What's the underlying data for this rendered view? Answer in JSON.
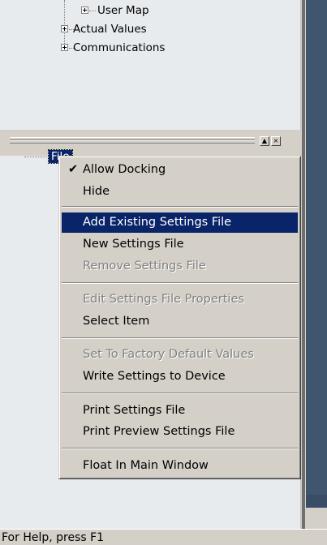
{
  "tree_top": {
    "items": [
      {
        "label": "User Map"
      },
      {
        "label": "Actual Values"
      },
      {
        "label": "Communications"
      }
    ]
  },
  "bottom_panel": {
    "node_label": "File",
    "buttons": {
      "restore_glyph": "▲",
      "close_glyph": "×"
    }
  },
  "context_menu": {
    "items": [
      {
        "label": "Allow Docking",
        "checked": true
      },
      {
        "label": "Hide"
      },
      {
        "label": "Add Existing Settings File",
        "highlighted": true
      },
      {
        "label": "New Settings File"
      },
      {
        "label": "Remove Settings File",
        "disabled": true
      },
      {
        "label": "Edit Settings File Properties",
        "disabled": true
      },
      {
        "label": "Select Item"
      },
      {
        "label": "Set To Factory Default Values",
        "disabled": true
      },
      {
        "label": "Write Settings to Device"
      },
      {
        "label": "Print Settings File"
      },
      {
        "label": "Print Preview Settings File"
      },
      {
        "label": "Float In Main Window"
      }
    ],
    "check_glyph": "✔"
  },
  "status_bar": {
    "text": "For Help, press F1"
  },
  "colors": {
    "highlight": "#0a246a",
    "panel": "#e8ebee",
    "chrome": "#d4d0c8"
  }
}
